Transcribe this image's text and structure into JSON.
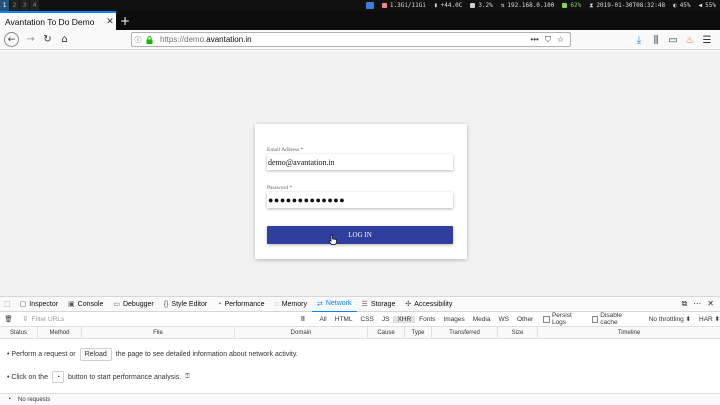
{
  "system_bar": {
    "workspaces": [
      "1",
      "2",
      "3",
      "4"
    ],
    "active_workspace": "1",
    "memory": "1.3Gi/11Gi",
    "temperature": "+44.0C",
    "cpu": "3.2%",
    "ip": "192.168.0.100",
    "battery": "62%",
    "datetime": "2019-01-30T08:32:48",
    "brightness": "45%",
    "volume": "55%"
  },
  "browser": {
    "tab_title": "Avantation To Do Demo",
    "url_scheme": "https://demo.",
    "url_host": "avantation.in"
  },
  "login": {
    "email_label": "Email Address *",
    "email_value": "demo@avantation.in",
    "password_label": "Password *",
    "password_value": "●●●●●●●●●●●●●",
    "button_label": "LOG IN"
  },
  "devtools": {
    "tabs": [
      "Inspector",
      "Console",
      "Debugger",
      "Style Editor",
      "Performance",
      "Memory",
      "Network",
      "Storage",
      "Accessibility"
    ],
    "selected_tab": "Network",
    "filter_placeholder": "Filter URLs",
    "pause_label": "II",
    "type_filters": [
      "All",
      "HTML",
      "CSS",
      "JS",
      "XHR",
      "Fonts",
      "Images",
      "Media",
      "WS",
      "Other"
    ],
    "selected_type_filter": "XHR",
    "persist_logs": "Persist Logs",
    "disable_cache": "Disable cache",
    "throttling": "No throttling ⬍",
    "har": "HAR ⬍",
    "columns": [
      "Status",
      "Method",
      "File",
      "Domain",
      "Cause",
      "Type",
      "Transferred",
      "Size",
      "Timeline"
    ],
    "message1_before": "• Perform a request or",
    "message1_button": "Reload",
    "message1_after": "the page to see detailed information about network activity.",
    "message2_before": "• Click on the",
    "message2_after": "button to start performance analysis.",
    "status_text": "No requests"
  },
  "colors": {
    "accent": "#0a84ff",
    "login_button": "#303f9f"
  }
}
